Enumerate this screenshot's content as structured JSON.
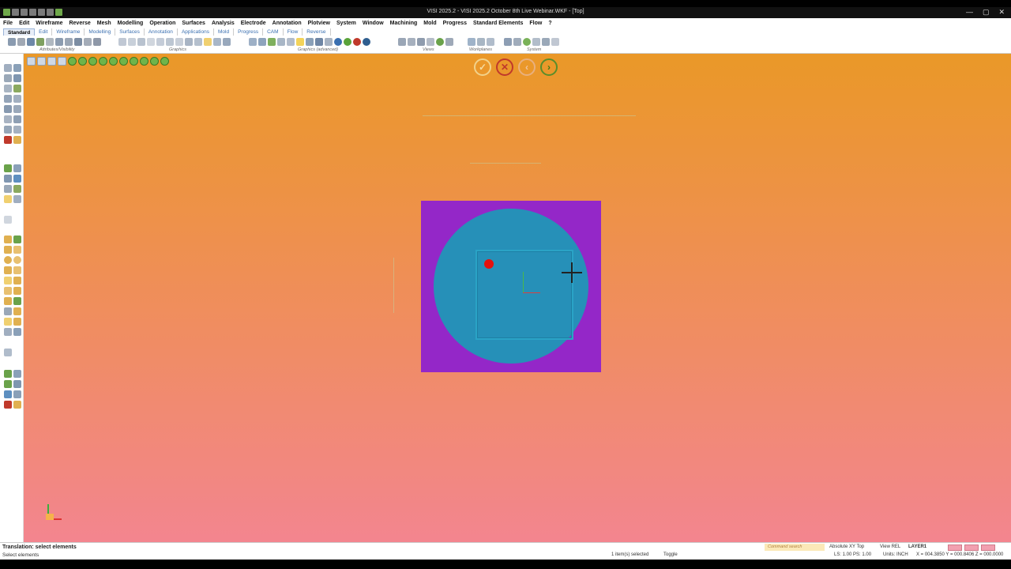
{
  "window": {
    "title": "VISI 2025.2 - VISI 2025.2 October 8th Live Webinar.WKF - [Top]",
    "controls": [
      "—",
      "▢",
      "✕"
    ]
  },
  "menu": [
    "File",
    "Edit",
    "Wireframe",
    "Reverse",
    "Mesh",
    "Modelling",
    "Operation",
    "Surfaces",
    "Analysis",
    "Electrode",
    "Annotation",
    "Plotview",
    "System",
    "Window",
    "Machining",
    "Mold",
    "Progress",
    "Standard Elements",
    "Flow",
    "?"
  ],
  "ribbon_tabs": [
    "Standard",
    "Edit",
    "Wireframe",
    "Modelling",
    "Surfaces",
    "Annotation",
    "Applications",
    "Mold",
    "Progress",
    "CAM",
    "Flow",
    "Reverse"
  ],
  "ribbon_groups": [
    "Attributes/Visibility",
    "Graphics",
    "Graphics (advanced)",
    "Views",
    "Workplanes",
    "System"
  ],
  "nav": {
    "ok": "✓",
    "cancel": "✕",
    "back": "‹",
    "next": "›"
  },
  "status": {
    "message": "Translation: select elements",
    "prompt": "Select elements",
    "selected": "1 item(s) selected",
    "toggle": "Toggle",
    "command_search": "Command search",
    "workplane": "Absolute XY Top",
    "view": "View REL",
    "layer": "LAYER1",
    "scale": "LS: 1.00 PS: 1.00",
    "units": "Units: INCH",
    "coords": "X = 004.3850 Y = 000.8406 Z = 000.0000"
  },
  "colors": {
    "part_face": "#9427c8",
    "disk": "#2690b8",
    "point": "#e5100d",
    "bg_top": "#ea9828",
    "bg_bottom": "#f3858f"
  }
}
